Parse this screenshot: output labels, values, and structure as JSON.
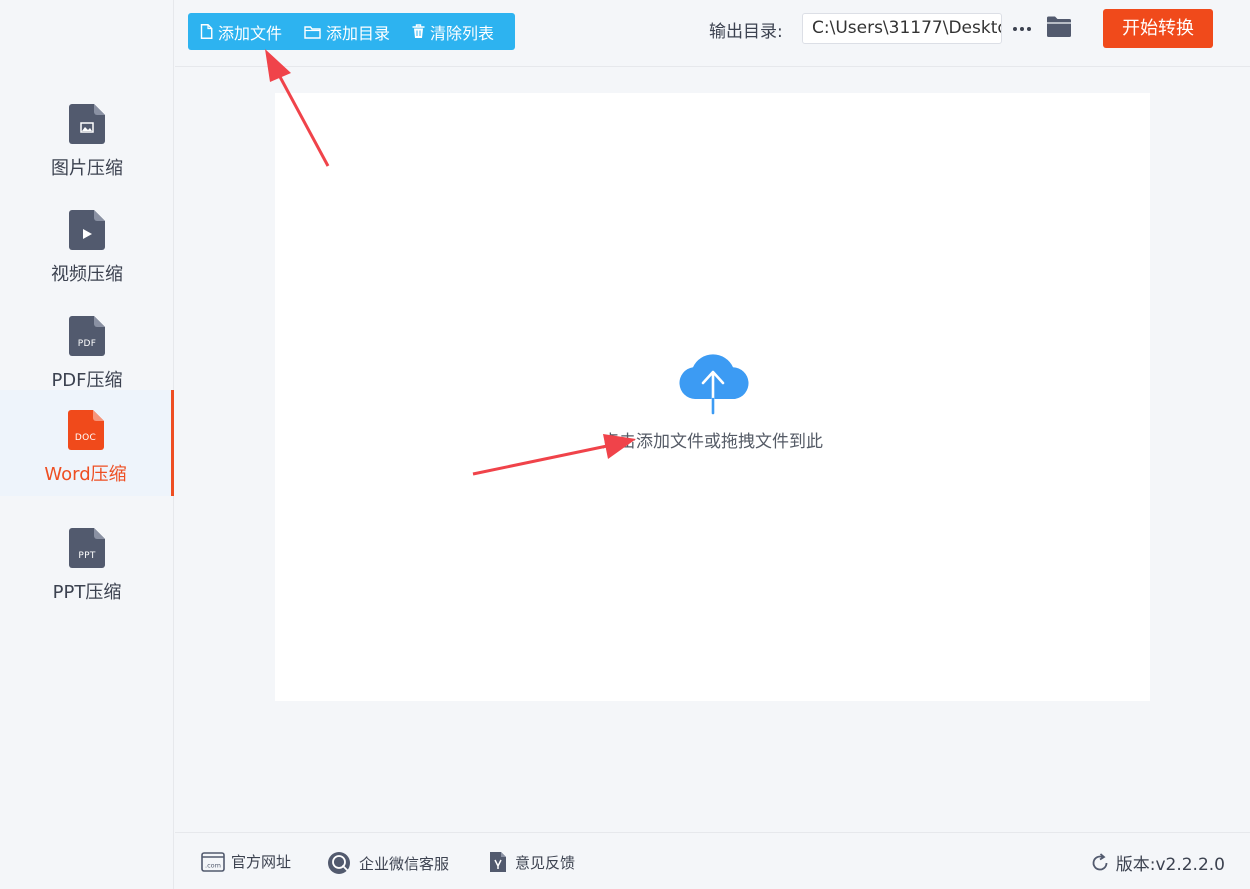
{
  "sidebar": {
    "items": [
      {
        "label": "图片压缩",
        "tag": "",
        "icon": "image-file-icon",
        "active": false
      },
      {
        "label": "视频压缩",
        "tag": "",
        "icon": "video-file-icon",
        "active": false
      },
      {
        "label": "PDF压缩",
        "tag": "PDF",
        "icon": "pdf-file-icon",
        "active": false
      },
      {
        "label": "Word压缩",
        "tag": "DOC",
        "icon": "doc-file-icon",
        "active": true
      },
      {
        "label": "PPT压缩",
        "tag": "PPT",
        "icon": "ppt-file-icon",
        "active": false
      }
    ]
  },
  "toolbar": {
    "add_file": "添加文件",
    "add_folder": "添加目录",
    "clear_list": "清除列表"
  },
  "output": {
    "label": "输出目录:",
    "path": "C:\\Users\\31177\\Deskto"
  },
  "start_button": "开始转换",
  "dropzone": {
    "text": "点击添加文件或拖拽文件到此"
  },
  "footer": {
    "website": "官方网址",
    "wechat": "企业微信客服",
    "feedback": "意见反馈",
    "version": "版本:v2.2.2.0"
  },
  "colors": {
    "accent": "#f04a1b",
    "toolbar": "#2db3f0",
    "cloud": "#3c9bf3",
    "icon_gray": "#525a6e",
    "annotation": "#f0434a"
  }
}
